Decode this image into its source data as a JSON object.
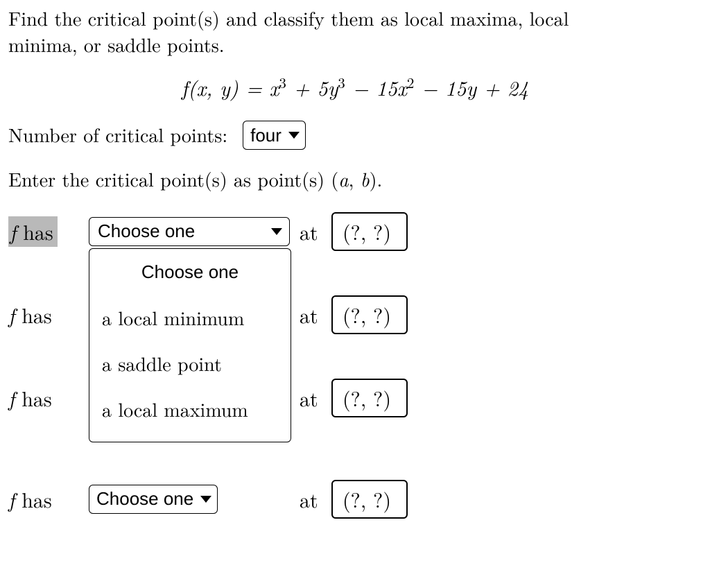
{
  "title_line1": "Find the critical point(s) and classify them as local maxima, local",
  "title_line2": "minima, or saddle points.",
  "equation_lhs": "f(x, y) = ",
  "equation_rhs_a": "x",
  "equation_rhs_b": " + 5y",
  "equation_rhs_c": " − 15x",
  "equation_rhs_d": " − 15y + 24",
  "exp3": "3",
  "exp2": "2",
  "num_cp_label": "Number of critical points:",
  "num_cp_value": "four",
  "enter_line": "Enter the critical point(s) as point(s) (a, b).",
  "fhas": "f has",
  "f_letter": "f",
  "has_word": " has",
  "choose_one": "Choose one",
  "at": "at",
  "placeholder": "(?, ?)",
  "options": {
    "header": "Choose one",
    "opt1": "a local minimum",
    "opt2": "a saddle point",
    "opt3": "a local maximum"
  }
}
